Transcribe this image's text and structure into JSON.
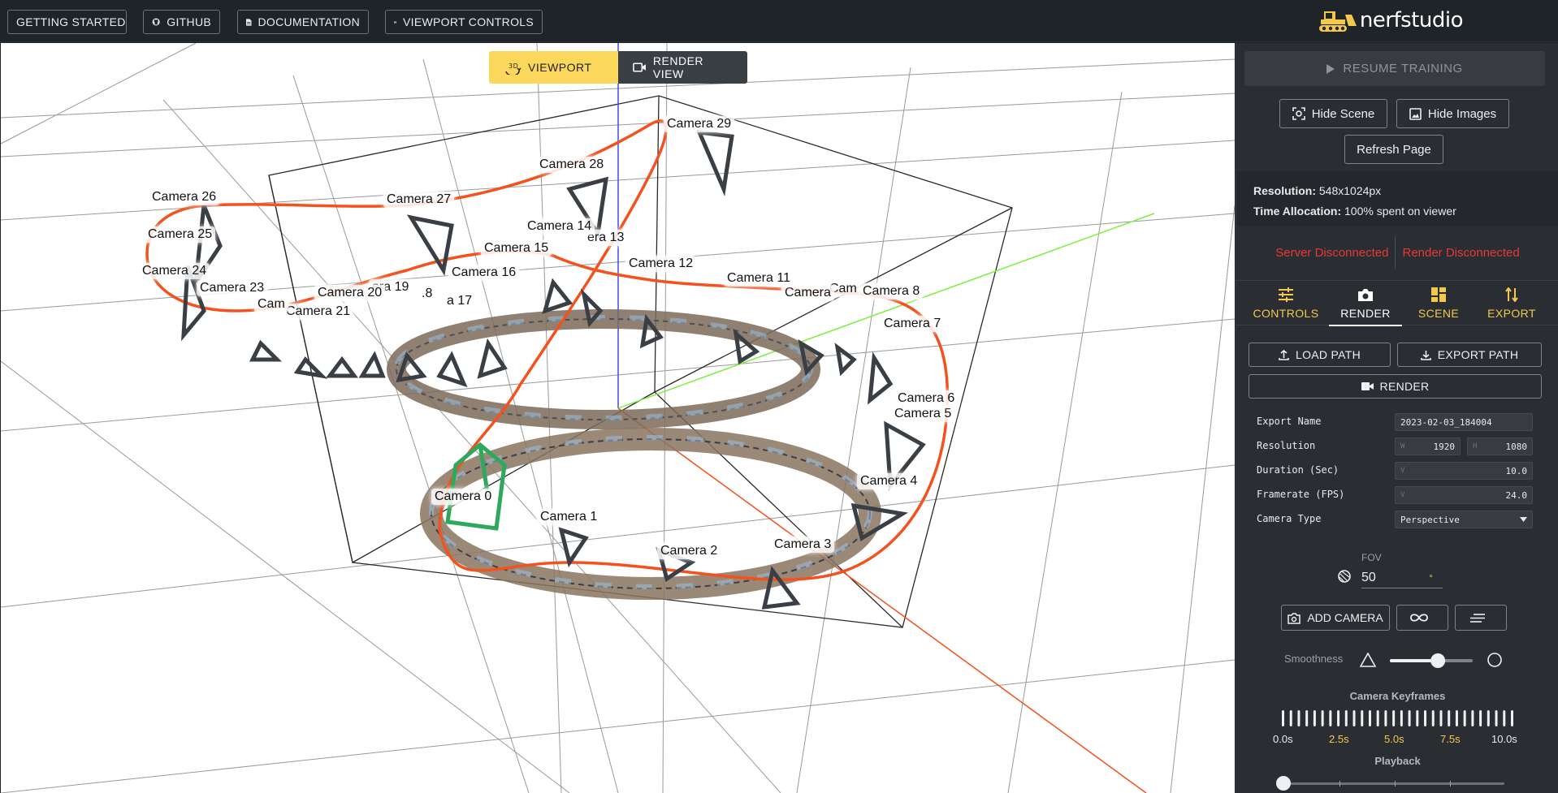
{
  "topbar": {
    "buttons": [
      {
        "label": "GETTING STARTED",
        "icon": "none"
      },
      {
        "label": "GITHUB",
        "icon": "github-icon"
      },
      {
        "label": "DOCUMENTATION",
        "icon": "document-icon"
      },
      {
        "label": "VIEWPORT CONTROLS",
        "icon": "keyboard-icon"
      }
    ],
    "logo_text": "nerfstudio"
  },
  "viewport": {
    "toggle": {
      "viewport_label": "VIEWPORT",
      "render_label": "RENDER VIEW"
    },
    "cameras": [
      {
        "label": "Camera 0"
      },
      {
        "label": "Camera 1"
      },
      {
        "label": "Camera 2"
      },
      {
        "label": "Camera 3"
      },
      {
        "label": "Camera 4"
      },
      {
        "label": "Camera 5"
      },
      {
        "label": "Camera 6"
      },
      {
        "label": "Camera 7"
      },
      {
        "label": "Camera 8"
      },
      {
        "label": "Cam"
      },
      {
        "label": "Camera"
      },
      {
        "label": "Camera 11"
      },
      {
        "label": "Camera 12"
      },
      {
        "label": "era 13"
      },
      {
        "label": "Camera 14"
      },
      {
        "label": "Camera 15"
      },
      {
        "label": "Camera 16"
      },
      {
        "label": "a 17"
      },
      {
        "label": ".8"
      },
      {
        "label": "era 19"
      },
      {
        "label": "Camera 20"
      },
      {
        "label": "Camera 21"
      },
      {
        "label": "Cam"
      },
      {
        "label": "Camera 23"
      },
      {
        "label": "Camera 24"
      },
      {
        "label": "Camera 25"
      },
      {
        "label": "Camera 26"
      },
      {
        "label": "Camera 27"
      },
      {
        "label": "Camera 28"
      },
      {
        "label": "Camera 29"
      }
    ],
    "colors": {
      "path": "#f4511e",
      "active_camera": "#2ea85a",
      "axis_x": "#f4511e",
      "axis_y": "#7cf03a",
      "axis_z": "#3b4cf0"
    }
  },
  "panel": {
    "resume_label": "RESUME TRAINING",
    "hide_scene_label": "Hide Scene",
    "hide_images_label": "Hide Images",
    "refresh_label": "Refresh Page",
    "resolution_key": "Resolution:",
    "resolution_value": "548x1024px",
    "time_key": "Time Allocation:",
    "time_value": "100% spent on viewer",
    "server_status": "Server Disconnected",
    "render_status": "Render Disconnected",
    "tabs": [
      {
        "label": "CONTROLS",
        "icon": "sliders-icon"
      },
      {
        "label": "RENDER",
        "icon": "camera-icon"
      },
      {
        "label": "SCENE",
        "icon": "grid-icon"
      },
      {
        "label": "EXPORT",
        "icon": "arrows-icon"
      }
    ],
    "load_path_label": "LOAD PATH",
    "export_path_label": "EXPORT PATH",
    "render_label": "RENDER",
    "fields": {
      "export_name_label": "Export Name",
      "export_name_value": "2023-02-03_184004",
      "resolution_label": "Resolution",
      "res_w_ph": "W",
      "res_w": "1920",
      "res_h_ph": "H",
      "res_h": "1080",
      "duration_label": "Duration (Sec)",
      "duration_ph": "V",
      "duration": "10.0",
      "framerate_label": "Framerate (FPS)",
      "framerate_ph": "V",
      "framerate": "24.0",
      "camera_type_label": "Camera Type",
      "camera_type": "Perspective"
    },
    "fov_label": "FOV",
    "fov_value": "50",
    "fov_unit": "°",
    "add_camera_label": "ADD CAMERA",
    "smoothness_label": "Smoothness",
    "smoothness_value": 0.58,
    "keyframes_title": "Camera Keyframes",
    "keyframe_count": 30,
    "times": [
      "0.0s",
      "2.5s",
      "5.0s",
      "7.5s",
      "10.0s"
    ],
    "playback_label": "Playback",
    "playback_value": 0.0
  }
}
